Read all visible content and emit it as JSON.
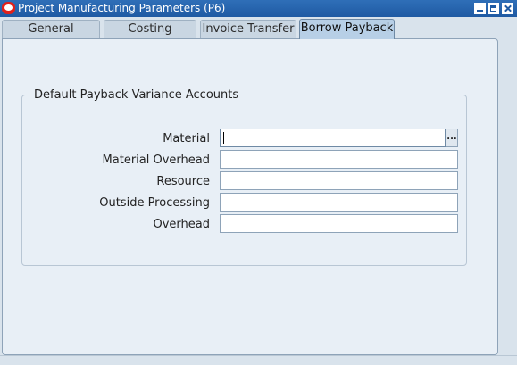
{
  "window": {
    "title": "Project Manufacturing Parameters (P6)"
  },
  "tabs": [
    {
      "label": "General",
      "active": false
    },
    {
      "label": "Costing",
      "active": false
    },
    {
      "label": "Invoice Transfer",
      "active": false
    },
    {
      "label": "Borrow Payback",
      "active": true
    }
  ],
  "group": {
    "title": "Default Payback Variance Accounts"
  },
  "fields": [
    {
      "label": "Material",
      "value": ""
    },
    {
      "label": "Material Overhead",
      "value": ""
    },
    {
      "label": "Resource",
      "value": ""
    },
    {
      "label": "Outside Processing",
      "value": ""
    },
    {
      "label": "Overhead",
      "value": ""
    }
  ],
  "lov_button": {
    "label": "..."
  },
  "colors": {
    "titlebar": "#1f5aa3",
    "active_tab": "#b7cfe6",
    "panel": "#e8eff6",
    "app_icon": "#e0201b"
  }
}
